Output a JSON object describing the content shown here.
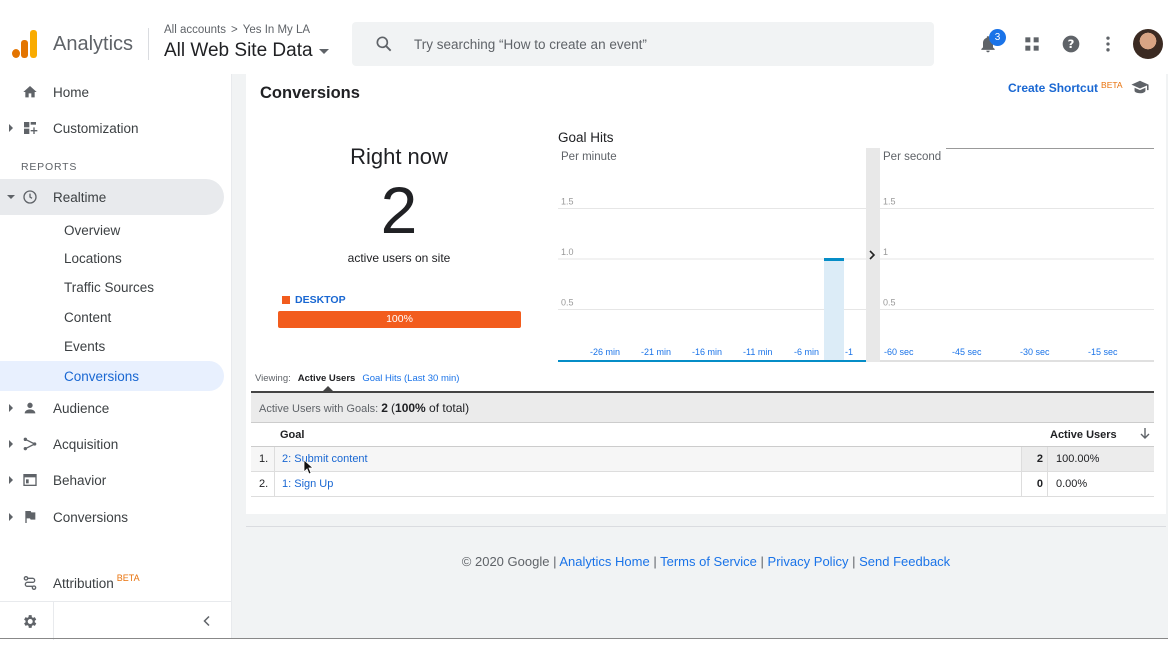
{
  "header": {
    "app_name": "Analytics",
    "breadcrumb_root": "All accounts",
    "breadcrumb_sep": ">",
    "breadcrumb_account": "Yes In My LA",
    "view_name": "All Web Site Data",
    "search_placeholder": "Try searching “How to create an event”",
    "notification_count": "3",
    "logo_colors": [
      "#f9ab00",
      "#e37400",
      "#e37400"
    ]
  },
  "sidebar": {
    "home": "Home",
    "customization": "Customization",
    "reports_label": "REPORTS",
    "realtime": "Realtime",
    "realtime_items": [
      "Overview",
      "Locations",
      "Traffic Sources",
      "Content",
      "Events",
      "Conversions"
    ],
    "audience": "Audience",
    "acquisition": "Acquisition",
    "behavior": "Behavior",
    "conversions": "Conversions",
    "attribution": "Attribution",
    "attribution_badge": "BETA"
  },
  "main": {
    "page_title": "Conversions",
    "create_shortcut": "Create Shortcut",
    "shortcut_badge": "BETA",
    "right_now_title": "Right now",
    "active_users": "2",
    "active_users_sub": "active users on site",
    "device_label": "DESKTOP",
    "device_percent": "100%",
    "device_fraction": 1.0,
    "goal_hits_title": "Goal Hits",
    "viewing_label": "Viewing:",
    "viewing_active": "Active Users",
    "viewing_other": "Goal Hits (Last 30 min)",
    "summary_label": "Active Users with Goals:",
    "summary_value": "2",
    "summary_open": "(",
    "summary_pct": "100%",
    "summary_rest": " of total)",
    "table_headers": {
      "goal": "Goal",
      "active_users": "Active Users"
    },
    "rows": [
      {
        "idx": "1.",
        "goal": "2: Submit content",
        "value": "2",
        "pct": "100.00%"
      },
      {
        "idx": "2.",
        "goal": "1: Sign Up",
        "value": "0",
        "pct": "0.00%"
      }
    ]
  },
  "chart_data": [
    {
      "type": "bar",
      "title": "Per minute",
      "x_ticks": [
        "-26 min",
        "-21 min",
        "-16 min",
        "-11 min",
        "-6 min",
        "-1"
      ],
      "y_ticks": [
        "1.5",
        "1.0",
        "0.5"
      ],
      "ylim": [
        0,
        2
      ],
      "bars": [
        {
          "x": "-2 min",
          "value": 1
        }
      ],
      "color": "#058dc7"
    },
    {
      "type": "bar",
      "title": "Per second",
      "x_ticks": [
        "-60 sec",
        "-45 sec",
        "-30 sec",
        "-15 sec"
      ],
      "y_ticks": [
        "1.5",
        "1",
        "0.5"
      ],
      "ylim": [
        0,
        2
      ],
      "bars": []
    }
  ],
  "footer": {
    "copyright": "© 2020 Google",
    "sep": "|",
    "links": [
      "Analytics Home",
      "Terms of Service",
      "Privacy Policy",
      "Send Feedback"
    ]
  }
}
